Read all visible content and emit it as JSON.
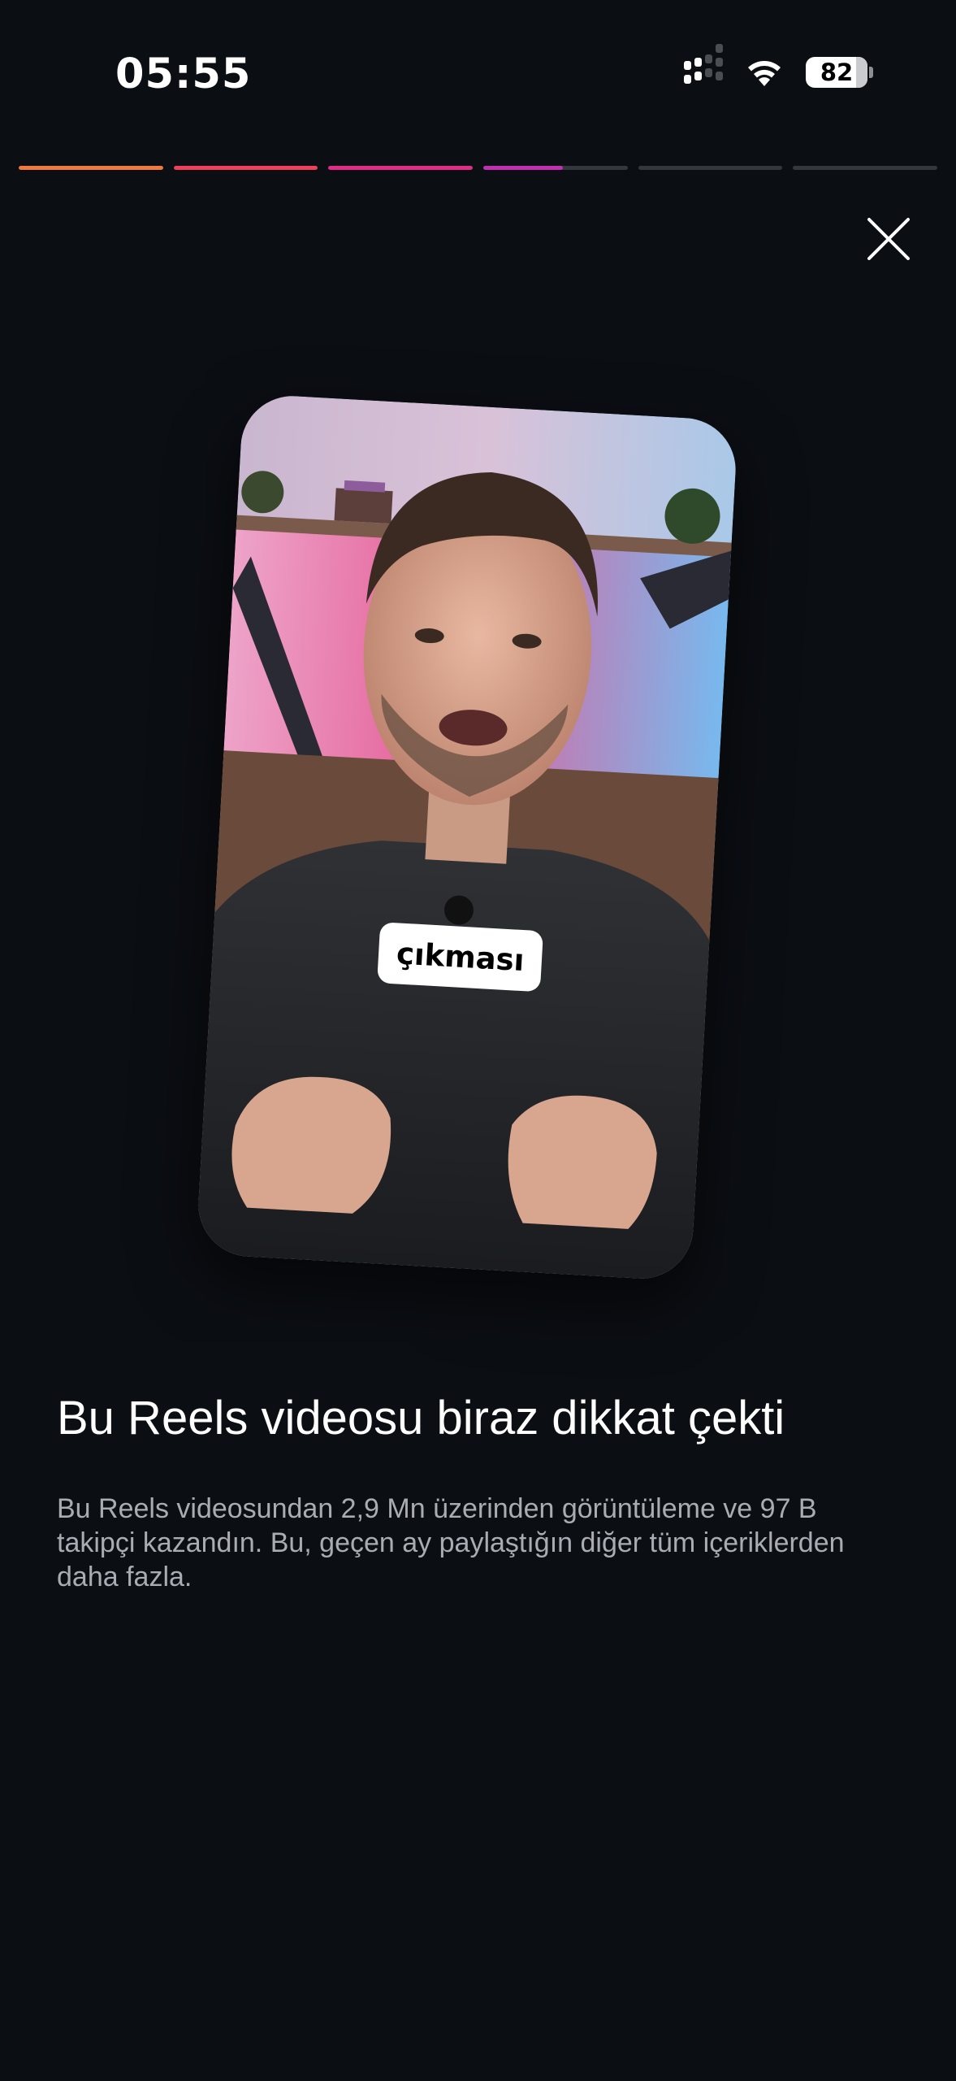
{
  "status_bar": {
    "time": "05:55",
    "battery_percent": "82",
    "icons": [
      "cellular-signal-icon",
      "wifi-icon",
      "battery-icon"
    ]
  },
  "story_progress": {
    "segment_count": 6,
    "current_segment": 4,
    "current_segment_fill": 0.55,
    "colors": [
      "#f07a3c",
      "#ef3f5b",
      "#e02c86",
      "#c22fb3"
    ],
    "track_color": "#33373e"
  },
  "close_button": {
    "icon": "close-icon"
  },
  "reel_preview": {
    "caption_text": "çıkması"
  },
  "content": {
    "headline": "Bu Reels videosu biraz dikkat çekti",
    "body": "Bu Reels videosundan 2,9 Mn üzerinden görüntüleme ve 97 B takipçi kazandın. Bu, geçen ay paylaştığın diğer tüm içeriklerden daha fazla."
  },
  "colors": {
    "background": "#0b0e13",
    "headline": "#ffffff",
    "body": "#a9acb2"
  }
}
